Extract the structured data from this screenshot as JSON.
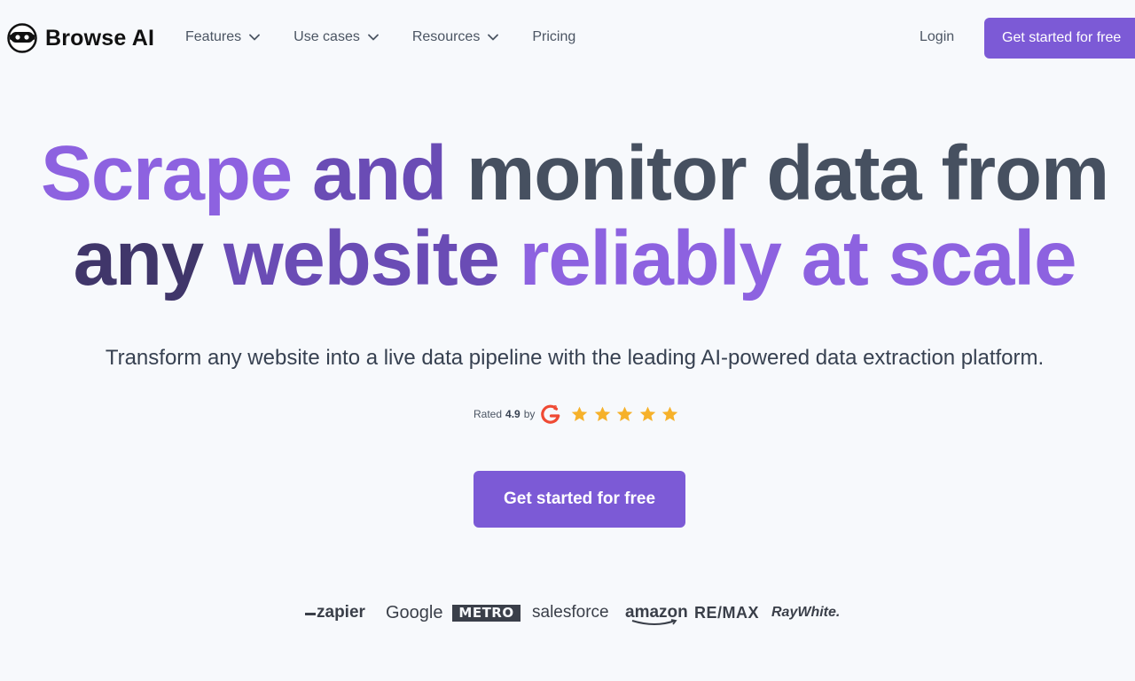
{
  "brand": {
    "name": "Browse AI",
    "accent": "#7c5ad6"
  },
  "nav": {
    "items": [
      {
        "label": "Features",
        "has_dropdown": true
      },
      {
        "label": "Use cases",
        "has_dropdown": true
      },
      {
        "label": "Resources",
        "has_dropdown": true
      },
      {
        "label": "Pricing",
        "has_dropdown": false
      }
    ],
    "login_label": "Login",
    "cta_label": "Get started for free"
  },
  "hero": {
    "headline_words": {
      "w1": "Scrape",
      "w2": "and",
      "w3": "monitor data from",
      "w4": "any",
      "w5": "website",
      "w6": "reliably at scale"
    },
    "headline_colors": {
      "purple": "#8d62e0",
      "gray": "#465060",
      "dark": "#40366a",
      "mid": "#6a4cb5"
    },
    "subtitle": "Transform any website into a live data pipeline with the leading AI-powered data extraction platform.",
    "rating": {
      "prefix": "Rated",
      "score": "4.9",
      "suffix": "by",
      "platform_icon": "g2-logo-icon",
      "stars": 5,
      "star_color": "#f6b12a"
    },
    "cta_label": "Get started for free"
  },
  "customer_logos": [
    {
      "name": "zapier",
      "text": "zapier"
    },
    {
      "name": "google",
      "text": "Google"
    },
    {
      "name": "metro",
      "text": "METRO"
    },
    {
      "name": "salesforce",
      "text": "salesforce"
    },
    {
      "name": "amazon",
      "text": "amazon"
    },
    {
      "name": "remax",
      "text": "RE/MAX"
    },
    {
      "name": "raywhite",
      "text": "RayWhite."
    }
  ]
}
